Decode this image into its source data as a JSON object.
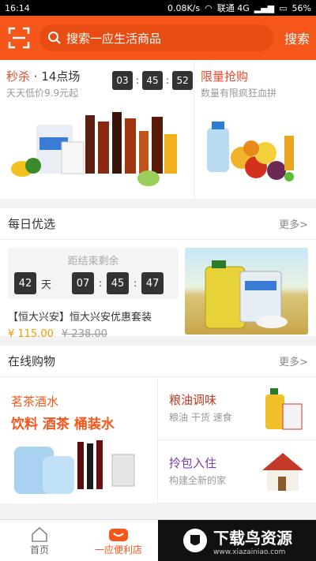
{
  "status": {
    "time": "16:14",
    "speed": "0.08K/s",
    "carrier": "联通 4G",
    "battery": "56%"
  },
  "search": {
    "placeholder": "搜索一应生活商品",
    "button": "搜索"
  },
  "flash_sale": {
    "label": "秒杀",
    "session": "· 14点场",
    "subtitle": "天天低价9.9元起",
    "timer": [
      "03",
      "45",
      "52"
    ]
  },
  "limited": {
    "title": "限量抢购",
    "subtitle": "数量有限疯狂血拼"
  },
  "daily": {
    "title": "每日优选",
    "more": "更多>",
    "countdown_label": "距结束剩余",
    "days": "42",
    "day_unit": "天",
    "time": [
      "07",
      "45",
      "47"
    ],
    "product": "【恒大兴安】恒大兴安优惠套装",
    "price": "¥ 115.00",
    "old_price": "¥ 238.00"
  },
  "online": {
    "title": "在线购物",
    "more": "更多>",
    "left_title": "茗茶酒水",
    "left_sub": "饮料 酒茶 桶装水",
    "cells": [
      {
        "title": "粮油调味",
        "subtitle": "粮油 干货 速食"
      },
      {
        "title": "拎包入住",
        "subtitle": "构建全新的家"
      }
    ]
  },
  "tabs": [
    {
      "label": "首页"
    },
    {
      "label": "一应便利店"
    }
  ],
  "watermark": {
    "title": "下载鸟资源",
    "url": "www.xiazainiao.com"
  },
  "colors": {
    "brand": "#f5571b",
    "accent_red": "#e8482d",
    "price": "#f59a00"
  }
}
